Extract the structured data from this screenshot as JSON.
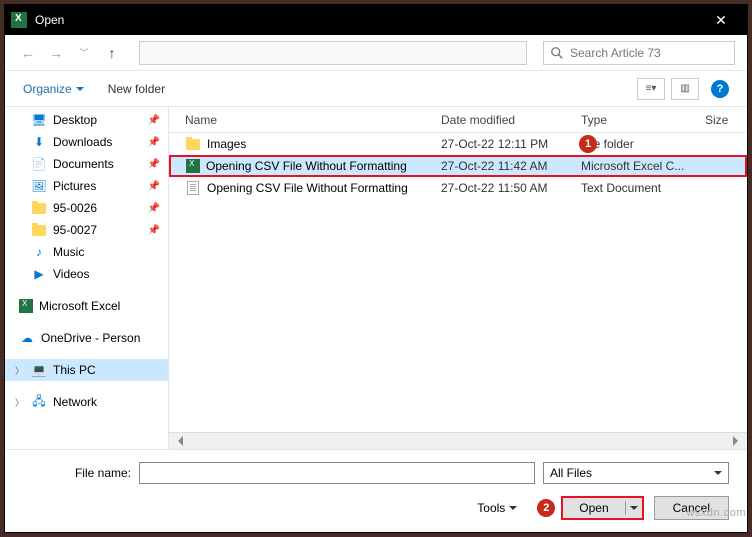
{
  "titlebar": {
    "title": "Open"
  },
  "search": {
    "placeholder": "Search Article 73"
  },
  "toolbar": {
    "organize": "Organize",
    "newfolder": "New folder"
  },
  "tree": {
    "items": [
      {
        "name": "Desktop",
        "icon": "desktop",
        "pin": true
      },
      {
        "name": "Downloads",
        "icon": "download",
        "pin": true
      },
      {
        "name": "Documents",
        "icon": "doc",
        "pin": true
      },
      {
        "name": "Pictures",
        "icon": "pic",
        "pin": true
      },
      {
        "name": "95-0026",
        "icon": "folder",
        "pin": true
      },
      {
        "name": "95-0027",
        "icon": "folder",
        "pin": true
      },
      {
        "name": "Music",
        "icon": "music",
        "pin": false
      },
      {
        "name": "Videos",
        "icon": "video",
        "pin": false
      },
      {
        "name": "Microsoft Excel",
        "icon": "excel",
        "pin": false,
        "gap": true
      },
      {
        "name": "OneDrive - Person",
        "icon": "onedrive",
        "pin": false,
        "gap": true
      },
      {
        "name": "This PC",
        "icon": "pc",
        "pin": false,
        "gap": true,
        "sel": true,
        "exp": true
      },
      {
        "name": "Network",
        "icon": "network",
        "pin": false,
        "gap": true,
        "exp": true
      }
    ]
  },
  "columns": {
    "name": "Name",
    "date": "Date modified",
    "type": "Type",
    "size": "Size"
  },
  "files": [
    {
      "name": "Images",
      "icon": "folder",
      "date": "27-Oct-22 12:11 PM",
      "type": "File folder",
      "sel": false
    },
    {
      "name": "Opening CSV File Without Formatting",
      "icon": "excel",
      "date": "27-Oct-22 11:42 AM",
      "type": "Microsoft Excel C...",
      "sel": true
    },
    {
      "name": "Opening CSV File Without Formatting",
      "icon": "textdoc",
      "date": "27-Oct-22 11:50 AM",
      "type": "Text Document",
      "sel": false
    }
  ],
  "bottom": {
    "filename_label": "File name:",
    "filter": "All Files",
    "tools": "Tools",
    "open": "Open",
    "cancel": "Cancel"
  },
  "badges": {
    "b1": "1",
    "b2": "2"
  },
  "watermark": "wsxdn.com"
}
